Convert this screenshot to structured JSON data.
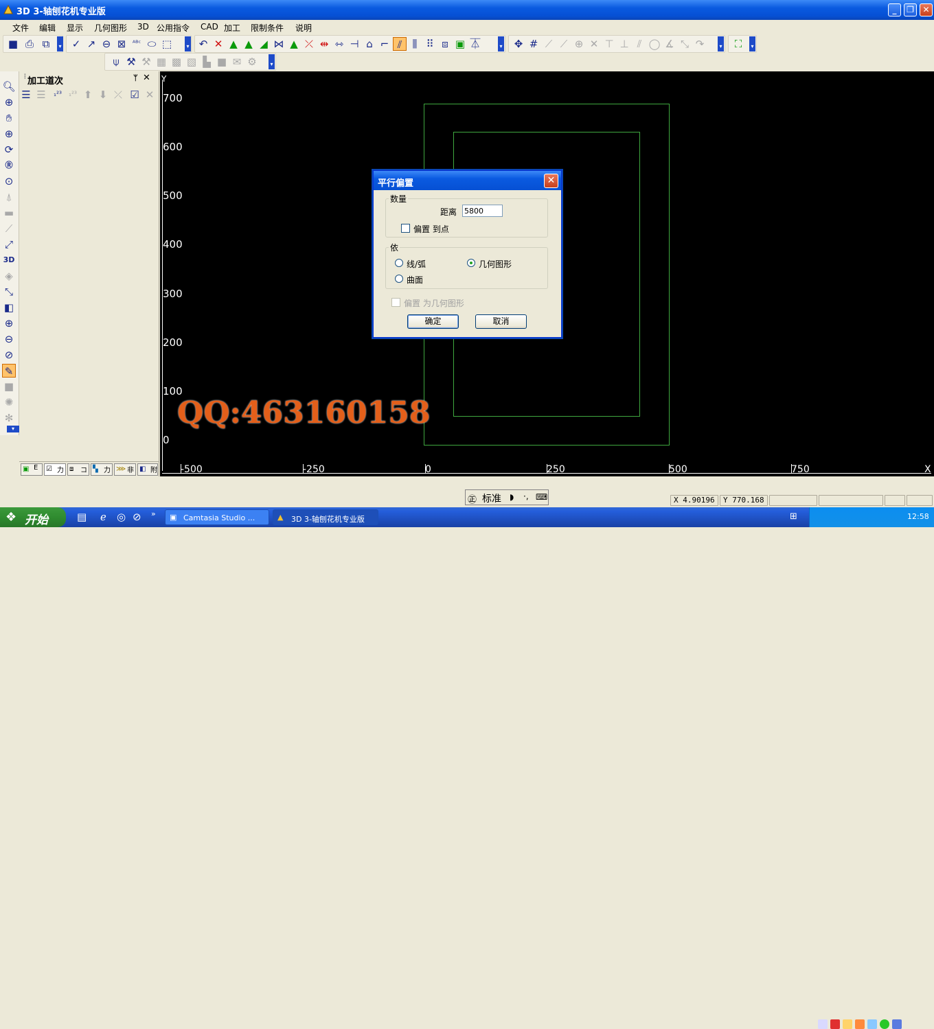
{
  "window": {
    "title": "3D 3-轴刨花机专业版"
  },
  "menu": [
    "文件",
    "编辑",
    "显示",
    "几何图形",
    "3D",
    "公用指令",
    "CAD",
    "加工",
    "限制条件",
    "说明"
  ],
  "panel": {
    "title": "加工道次",
    "tabs": [
      "E",
      "力",
      "コ",
      "力",
      "非",
      "附"
    ]
  },
  "canvas": {
    "y_axis_label": "Y",
    "x_axis_label": "X",
    "y_ticks": [
      "700",
      "600",
      "500",
      "400",
      "300",
      "200",
      "100",
      "0"
    ],
    "x_ticks": [
      "-500",
      "-250",
      "0",
      "250",
      "500",
      "750"
    ],
    "watermark": "QQ:463160158"
  },
  "dialog": {
    "title": "平行偏置",
    "group_amount": "数量",
    "distance_label": "距离",
    "distance_value": "5800",
    "offset_to_point_label": "偏置 到点",
    "group_by": "依",
    "opt_line_arc": "线/弧",
    "opt_geometry": "几何图形",
    "opt_surface": "曲面",
    "offset_as_geometry_label": "偏置 为几何图形",
    "ok": "确定",
    "cancel": "取消"
  },
  "status": {
    "x": "X 4.90196",
    "y": "Y 770.168"
  },
  "ime": {
    "mode": "标准"
  },
  "taskbar": {
    "start": "开始",
    "tasks": [
      "Camtasia Studio ...",
      "3D 3-轴刨花机专业版"
    ],
    "clock": "12:58"
  },
  "colors": {
    "accent": "#0a5ae0",
    "canvas_bg": "#000000",
    "geometry": "#3fa83f",
    "watermark": "#e35f1a"
  }
}
